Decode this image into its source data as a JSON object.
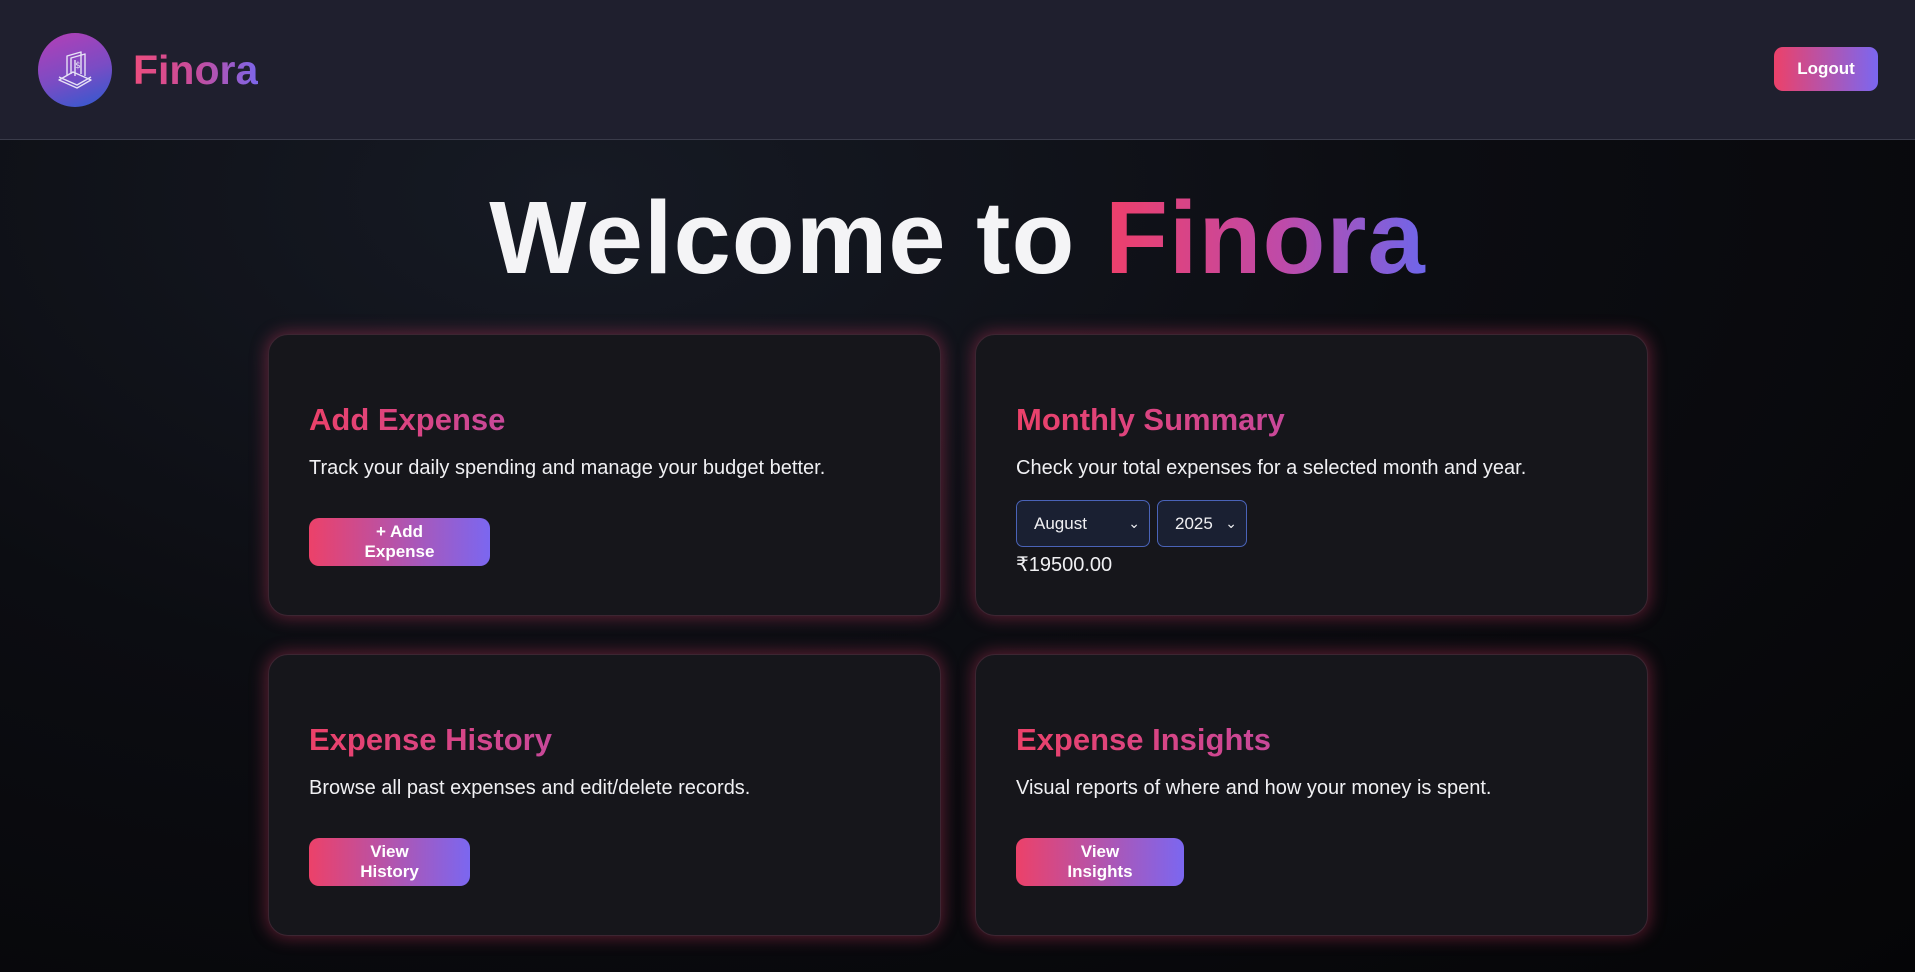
{
  "header": {
    "brand": "Finora",
    "logout_label": "Logout"
  },
  "hero": {
    "prefix": "Welcome to ",
    "accent": "Finora"
  },
  "cards": {
    "add_expense": {
      "title": "Add Expense",
      "description": "Track your daily spending and manage your budget better.",
      "button": "+ Add Expense"
    },
    "monthly_summary": {
      "title": "Monthly Summary",
      "description": "Check your total expenses for a selected month and year.",
      "month_selected": "August",
      "year_selected": "2025",
      "total": "₹19500.00"
    },
    "history": {
      "title": "Expense History",
      "description": "Browse all past expenses and edit/delete records.",
      "button": "View History"
    },
    "insights": {
      "title": "Expense Insights",
      "description": "Visual reports of where and how your money is spent.",
      "button": "View Insights"
    }
  },
  "icons": {
    "logo": "money-stack-icon",
    "dropdown": "chevron-down-icon"
  },
  "colors": {
    "accent_pink": "#ec4169",
    "accent_purple": "#7b67f0",
    "navbar_bg": "#1f1f2e",
    "card_bg": "#16161b"
  }
}
